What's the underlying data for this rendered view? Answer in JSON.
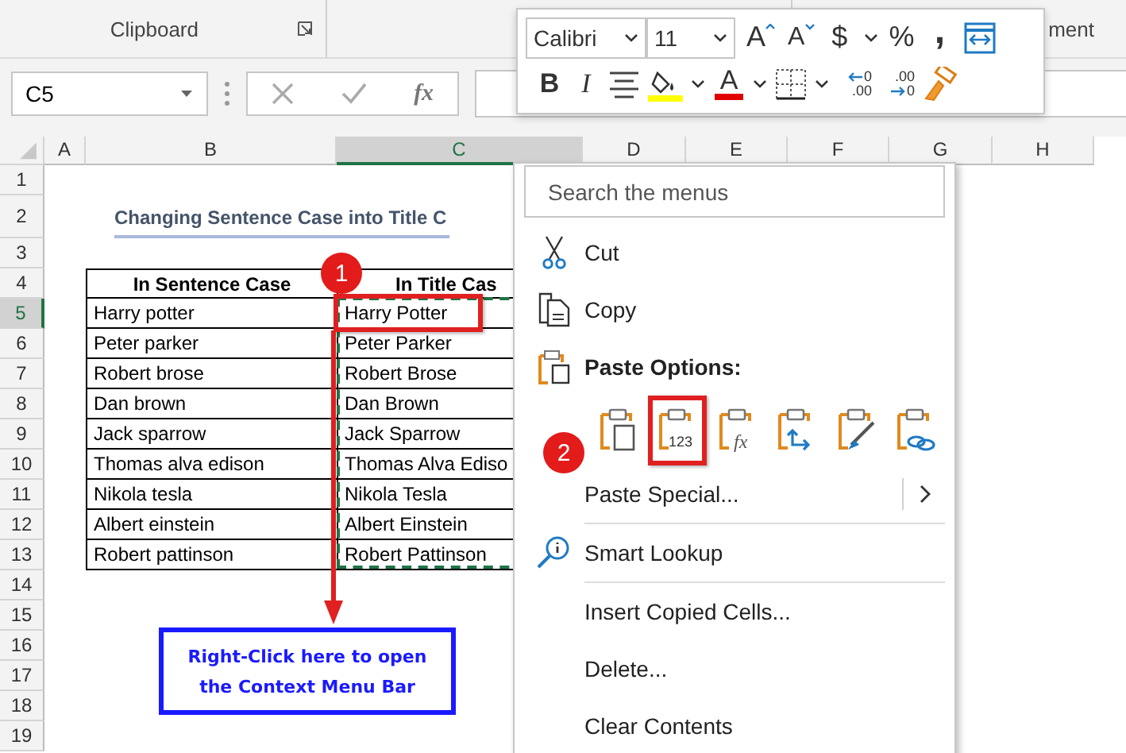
{
  "ribbon": {
    "group_label": "Clipboard",
    "next_group_label": "ment"
  },
  "formula_bar": {
    "name_box": "C5",
    "function_label": "fx"
  },
  "mini_toolbar": {
    "upper_row": [
      {
        "kind": "font-select",
        "label": "Calibri"
      },
      {
        "kind": "size-select",
        "label": "11"
      },
      {
        "kind": "grow-font",
        "label": "A"
      },
      {
        "kind": "shrink-font",
        "label": "A"
      },
      {
        "kind": "currency",
        "label": "$"
      },
      {
        "kind": "caret"
      },
      {
        "kind": "percent",
        "label": "%"
      },
      {
        "kind": "comma",
        "label": ","
      },
      {
        "kind": "wrap"
      }
    ],
    "lower_row": [
      {
        "kind": "bold",
        "label": "B"
      },
      {
        "kind": "italic",
        "label": "I"
      },
      {
        "kind": "align"
      },
      {
        "kind": "fill-color"
      },
      {
        "kind": "caret"
      },
      {
        "kind": "font-color",
        "label": "A"
      },
      {
        "kind": "caret"
      },
      {
        "kind": "borders"
      },
      {
        "kind": "caret"
      },
      {
        "kind": "decrease-decimal",
        "lines": [
          "0",
          ".00"
        ]
      },
      {
        "kind": "increase-decimal",
        "lines": [
          ".00",
          "0"
        ]
      },
      {
        "kind": "painter"
      }
    ]
  },
  "sheet": {
    "columns": [
      {
        "label": "A",
        "selected": false
      },
      {
        "label": "B",
        "selected": false
      },
      {
        "label": "C",
        "selected": true
      },
      {
        "label": "D",
        "selected": false
      },
      {
        "label": "E",
        "selected": false
      },
      {
        "label": "F",
        "selected": false
      },
      {
        "label": "G",
        "selected": false
      },
      {
        "label": "H",
        "selected": false
      }
    ],
    "rows": [
      {
        "label": "1",
        "selected": false,
        "kind": "blank"
      },
      {
        "label": "2",
        "selected": false,
        "kind": "title",
        "b": "Changing Sentence Case into Title C"
      },
      {
        "label": "3",
        "selected": false,
        "kind": "blank"
      },
      {
        "label": "4",
        "selected": false,
        "kind": "header",
        "b": "In Sentence Case",
        "c": "In Title Cas"
      },
      {
        "label": "5",
        "selected": true,
        "kind": "data",
        "b": "Harry potter",
        "c": "Harry Potter"
      },
      {
        "label": "6",
        "selected": false,
        "kind": "data",
        "b": "Peter parker",
        "c": "Peter Parker"
      },
      {
        "label": "7",
        "selected": false,
        "kind": "data",
        "b": "Robert brose",
        "c": "Robert Brose"
      },
      {
        "label": "8",
        "selected": false,
        "kind": "data",
        "b": "Dan brown",
        "c": "Dan Brown"
      },
      {
        "label": "9",
        "selected": false,
        "kind": "data",
        "b": "Jack sparrow",
        "c": "Jack Sparrow"
      },
      {
        "label": "10",
        "selected": false,
        "kind": "data",
        "b": "Thomas alva edison",
        "c": "Thomas Alva Ediso"
      },
      {
        "label": "11",
        "selected": false,
        "kind": "data",
        "b": "Nikola tesla",
        "c": "Nikola Tesla"
      },
      {
        "label": "12",
        "selected": false,
        "kind": "data",
        "b": "Albert einstein",
        "c": "Albert Einstein"
      },
      {
        "label": "13",
        "selected": false,
        "kind": "data",
        "b": "Robert pattinson",
        "c": "Robert Pattinson"
      },
      {
        "label": "14",
        "selected": false,
        "kind": "blank"
      },
      {
        "label": "15",
        "selected": false,
        "kind": "blank"
      },
      {
        "label": "16",
        "selected": false,
        "kind": "blank"
      },
      {
        "label": "17",
        "selected": false,
        "kind": "blank"
      },
      {
        "label": "18",
        "selected": false,
        "kind": "blank"
      },
      {
        "label": "19",
        "selected": false,
        "kind": "blank"
      }
    ]
  },
  "context_menu": {
    "search": {
      "placeholder": "Search the menus"
    },
    "items": [
      {
        "kind": "cut",
        "label": "Cut",
        "separator_after": false
      },
      {
        "kind": "copy",
        "label": "Copy",
        "separator_after": false
      },
      {
        "kind": "paste-heading",
        "label": "Paste Options:",
        "separator_after": false
      },
      {
        "kind": "paste-options",
        "separator_after": false,
        "options": [
          {
            "kind": "paste",
            "highlighted": false
          },
          {
            "kind": "values",
            "label": "123",
            "highlighted": true
          },
          {
            "kind": "formulas",
            "label": "fx",
            "highlighted": false
          },
          {
            "kind": "transpose",
            "highlighted": false
          },
          {
            "kind": "formatting",
            "highlighted": false
          },
          {
            "kind": "link",
            "highlighted": false
          }
        ]
      },
      {
        "kind": "submenu",
        "label": "Paste Special...",
        "separator_after": true
      },
      {
        "kind": "lookup",
        "label": "Smart Lookup",
        "separator_after": true
      },
      {
        "kind": "plain",
        "label": "Insert Copied Cells...",
        "separator_after": false
      },
      {
        "kind": "plain",
        "label": "Delete...",
        "separator_after": false
      },
      {
        "kind": "plain",
        "label": "Clear Contents",
        "separator_after": false
      }
    ]
  },
  "annotations": {
    "badges": [
      {
        "label": "1"
      },
      {
        "label": "2"
      }
    ],
    "callout": "Right-Click here to open the Context Menu Bar"
  }
}
